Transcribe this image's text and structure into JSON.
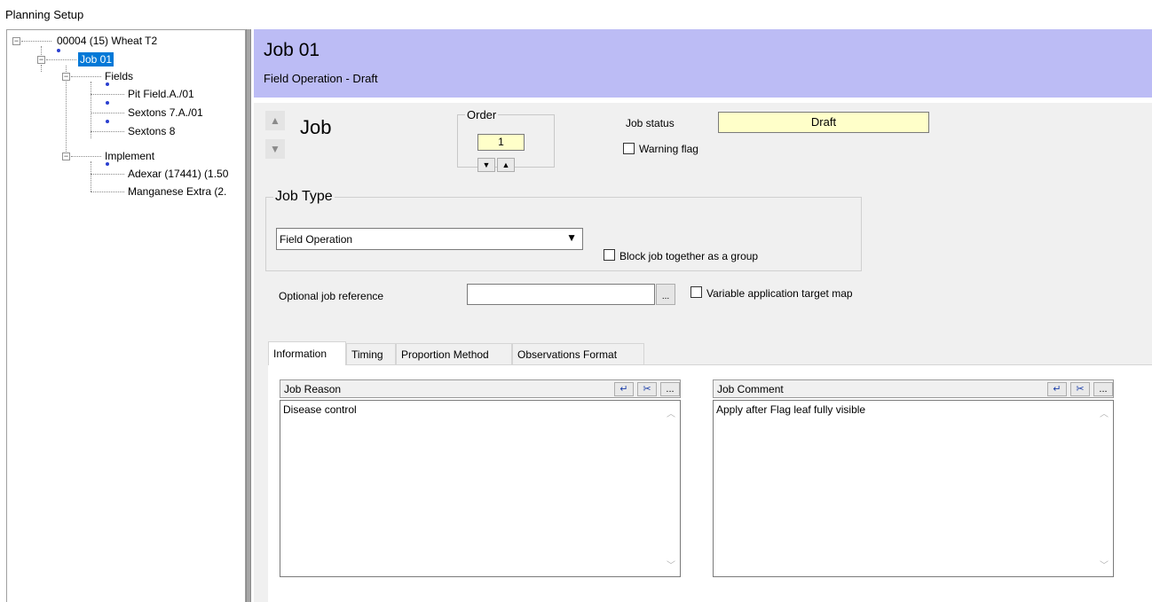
{
  "window": {
    "title": "Planning Setup"
  },
  "tree": {
    "root_label": "00004 (15) Wheat T2",
    "job_label": "Job 01",
    "fields_label": "Fields",
    "fields": [
      "Pit Field.A./01",
      "Sextons 7.A./01",
      "Sextons 8"
    ],
    "implement_label": "Implement",
    "implements": [
      "Adexar (17441) (1.50",
      "Manganese Extra (2."
    ],
    "selected": "Job 01"
  },
  "header": {
    "title": "Job 01",
    "subtitle": "Field Operation - Draft",
    "background": "#bcbcf5"
  },
  "job": {
    "label": "Job",
    "order_legend": "Order",
    "order_value": "1",
    "status_label": "Job status",
    "status_value": "Draft",
    "warning_flag_label": "Warning flag",
    "warning_flag_checked": false
  },
  "job_type": {
    "legend": "Job Type",
    "selected": "Field Operation",
    "block_group_label": "Block job together as a group",
    "block_group_checked": false
  },
  "reference": {
    "label": "Optional job reference",
    "value": "",
    "ellipsis": "...",
    "variable_map_label": "Variable application target map",
    "variable_map_checked": false
  },
  "tabs": [
    "Information",
    "Timing",
    "Proportion Method",
    "Observations Format"
  ],
  "active_tab": "Information",
  "reason": {
    "title": "Job Reason",
    "text": "Disease control",
    "ellipsis": "..."
  },
  "comment": {
    "title": "Job Comment",
    "text": "Apply after Flag leaf fully visible",
    "ellipsis": "..."
  },
  "colors": {
    "selection": "#0078d7",
    "highlight_field": "#ffffc9",
    "node_dot": "#2a3fd0"
  }
}
